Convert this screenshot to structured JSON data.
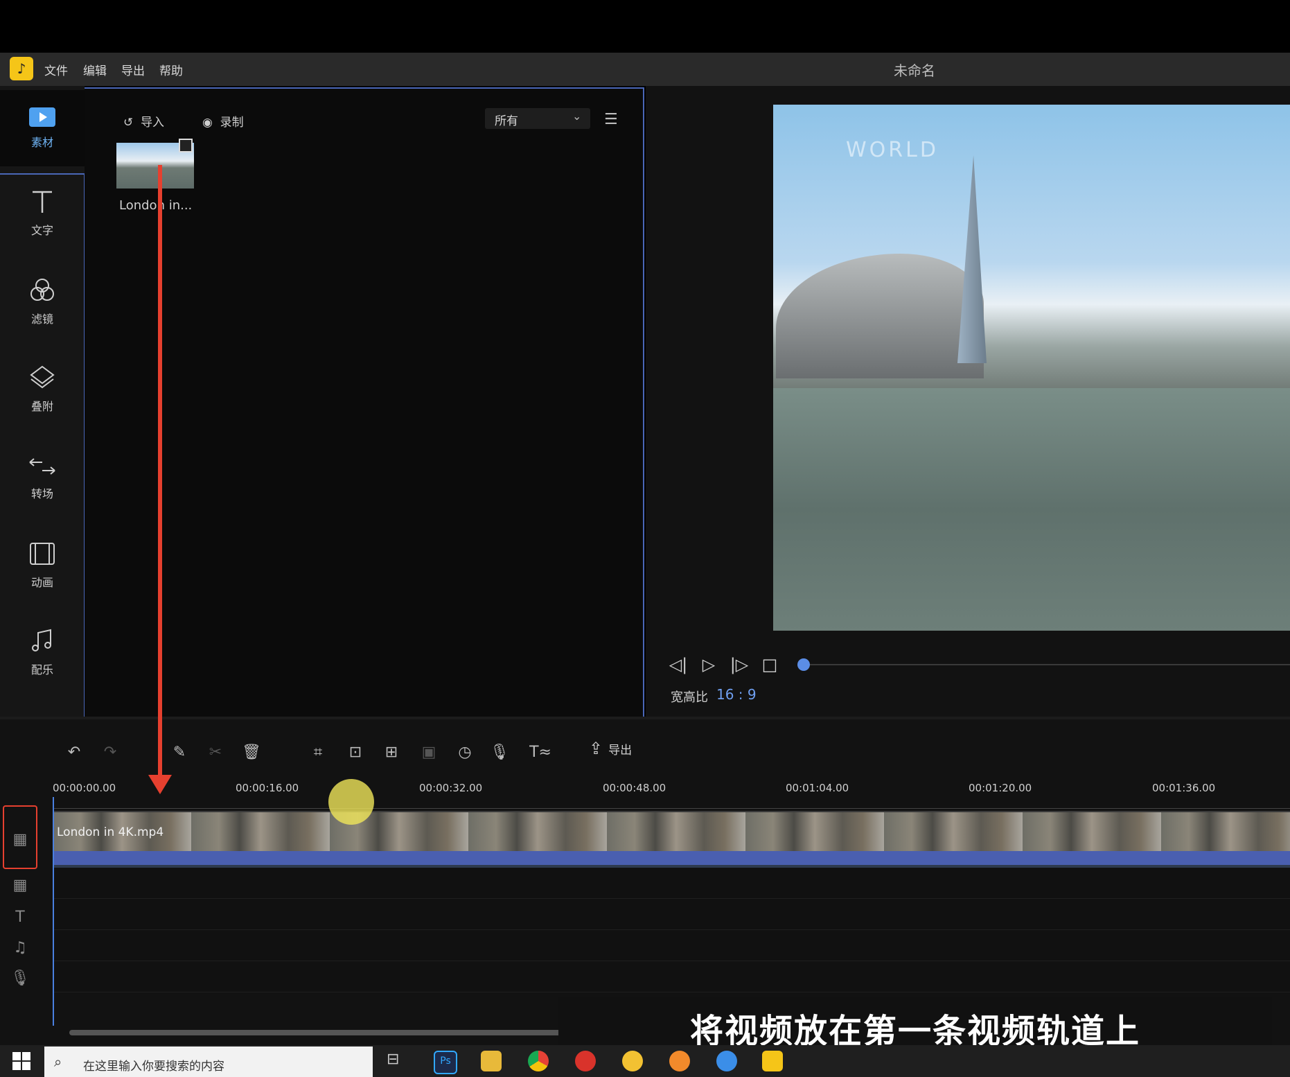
{
  "window": {
    "title": "未命名"
  },
  "menu": {
    "file": "文件",
    "edit": "编辑",
    "export": "导出",
    "help": "帮助"
  },
  "rail": [
    {
      "label": "素材",
      "icon": "media-icon"
    },
    {
      "label": "文字",
      "icon": "text-icon"
    },
    {
      "label": "滤镜",
      "icon": "filter-icon"
    },
    {
      "label": "叠附",
      "icon": "overlay-icon"
    },
    {
      "label": "转场",
      "icon": "transition-icon"
    },
    {
      "label": "动画",
      "icon": "animation-icon"
    },
    {
      "label": "配乐",
      "icon": "music-icon"
    }
  ],
  "media": {
    "import_label": "导入",
    "record_label": "录制",
    "filter_value": "所有",
    "items": [
      {
        "name": "London in..."
      }
    ]
  },
  "preview": {
    "aspect_label": "宽高比",
    "aspect_value": "16 : 9",
    "overlay_text": "WORLD"
  },
  "toolbar": {
    "export_label": "导出"
  },
  "timeline": {
    "ticks": [
      "00:00:00.00",
      "00:00:16.00",
      "00:00:32.00",
      "00:00:48.00",
      "00:01:04.00",
      "00:01:20.00",
      "00:01:36.00"
    ],
    "clip_name": "London in 4K.mp4"
  },
  "subtitle": "将视频放在第一条视频轨道上",
  "taskbar": {
    "search_placeholder": "在这里输入你要搜索的内容"
  },
  "colors": {
    "accent": "#4a67b8",
    "highlight": "#e6402f",
    "logo": "#f5c518",
    "aspect_value": "#6f9ff0"
  }
}
